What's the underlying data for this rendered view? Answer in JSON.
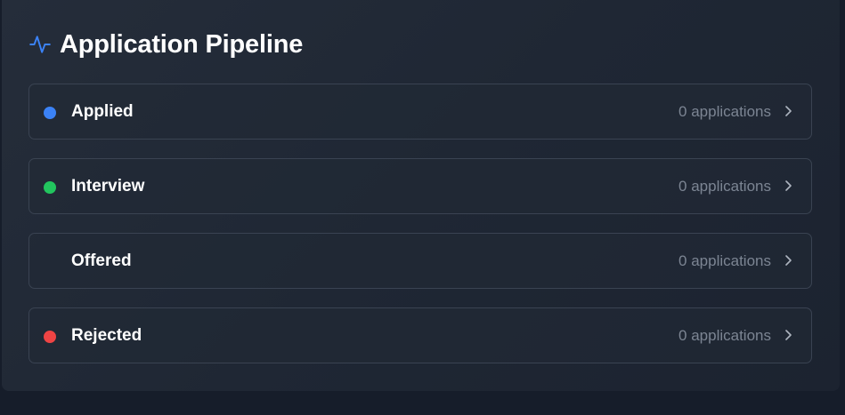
{
  "header": {
    "title": "Application Pipeline",
    "icon": "activity-icon",
    "icon_color": "#3b82f6"
  },
  "stages": [
    {
      "label": "Applied",
      "count": "0 applications",
      "color": "#3b82f6"
    },
    {
      "label": "Interview",
      "count": "0 applications",
      "color": "#22c55e"
    },
    {
      "label": "Offered",
      "count": "0 applications",
      "color": ""
    },
    {
      "label": "Rejected",
      "count": "0 applications",
      "color": "#ef4444"
    }
  ]
}
